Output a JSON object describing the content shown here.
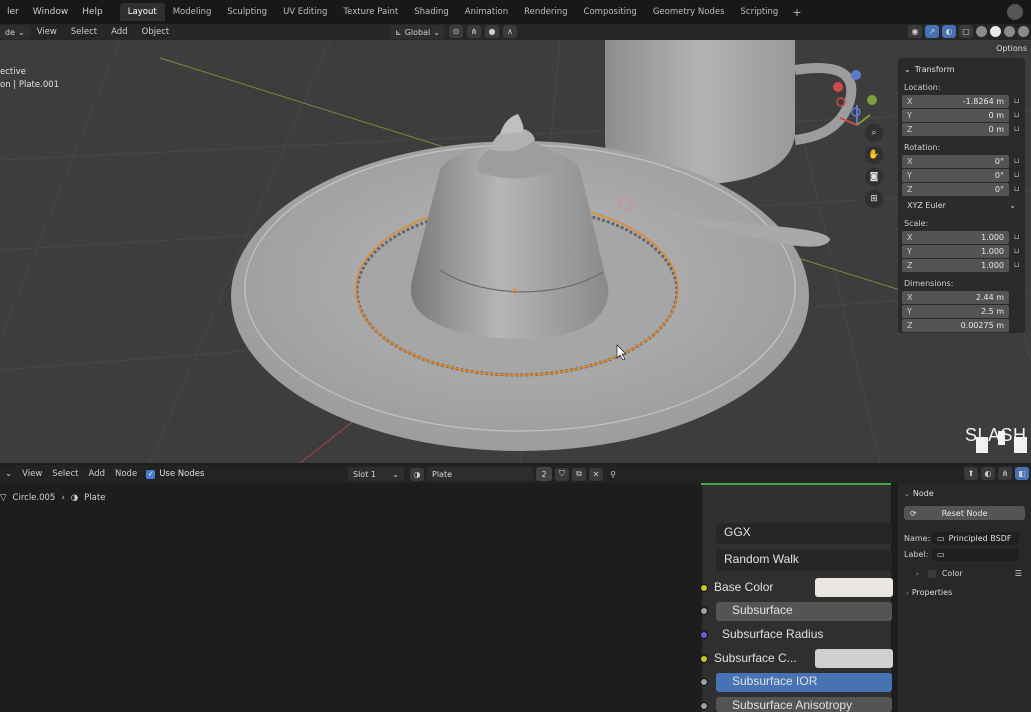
{
  "topbar": {
    "menus": [
      "ler",
      "Window",
      "Help"
    ],
    "workspaces": [
      "Layout",
      "Modeling",
      "Sculpting",
      "UV Editing",
      "Texture Paint",
      "Shading",
      "Animation",
      "Rendering",
      "Compositing",
      "Geometry Nodes",
      "Scripting"
    ],
    "active_workspace": "Layout",
    "add_tab": "+"
  },
  "viewport_header": {
    "mode": "de",
    "menus": [
      "View",
      "Select",
      "Add",
      "Object"
    ],
    "orientation": "Global",
    "options": "Options"
  },
  "viewport": {
    "info_line1": "ective",
    "info_line2": "on | Plate.001"
  },
  "transform_panel": {
    "title": "Transform",
    "location_label": "Location:",
    "location": [
      {
        "axis": "X",
        "value": "-1.8264 m"
      },
      {
        "axis": "Y",
        "value": "0 m"
      },
      {
        "axis": "Z",
        "value": "0 m"
      }
    ],
    "rotation_label": "Rotation:",
    "rotation": [
      {
        "axis": "X",
        "value": "0°"
      },
      {
        "axis": "Y",
        "value": "0°"
      },
      {
        "axis": "Z",
        "value": "0°"
      }
    ],
    "rotation_mode": "XYZ Euler",
    "scale_label": "Scale:",
    "scale": [
      {
        "axis": "X",
        "value": "1.000"
      },
      {
        "axis": "Y",
        "value": "1.000"
      },
      {
        "axis": "Z",
        "value": "1.000"
      }
    ],
    "dimensions_label": "Dimensions:",
    "dimensions": [
      {
        "axis": "X",
        "value": "2.44 m"
      },
      {
        "axis": "Y",
        "value": "2.5 m"
      },
      {
        "axis": "Z",
        "value": "0.00275 m"
      }
    ]
  },
  "watermark": {
    "text": "SLASH"
  },
  "node_header": {
    "menus": [
      "View",
      "Select",
      "Add",
      "Node"
    ],
    "use_nodes": "Use Nodes",
    "slot": "Slot 1",
    "material": "Plate",
    "user_count": "2"
  },
  "breadcrumb": {
    "object": "Circle.005",
    "material": "Plate"
  },
  "node": {
    "distribution": "GGX",
    "subsurface_method": "Random Walk",
    "inputs": {
      "base_color": "Base Color",
      "subsurface": "Subsurface",
      "subsurface_radius": "Subsurface Radius",
      "subsurface_color": "Subsurface C...",
      "subsurface_ior": "Subsurface IOR",
      "subsurface_anisotropy": "Subsurface Anisotropy"
    },
    "colors": {
      "base_color_swatch": "#e9e6e2",
      "subsurface_color_swatch": "#cfcfcf",
      "socket_yellow": "#c7c729",
      "socket_grey": "#a1a1a1",
      "socket_purple": "#6363c7"
    }
  },
  "node_panel": {
    "title": "Node",
    "reset": "Reset Node",
    "name_label": "Name:",
    "name_value": "Principled BSDF",
    "label_label": "Label:",
    "label_value": "",
    "color": "Color",
    "properties": "Properties"
  }
}
